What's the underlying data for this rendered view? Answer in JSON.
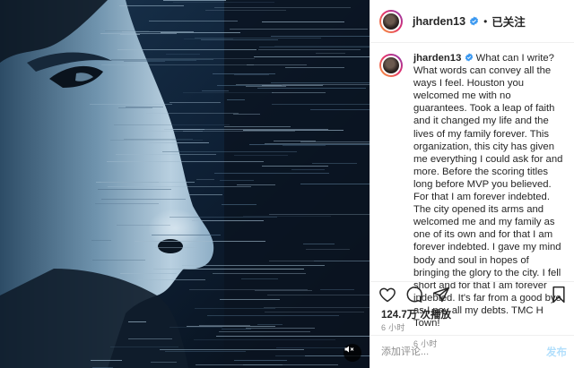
{
  "media": {
    "type": "video",
    "mute_icon": "speaker-mute-icon"
  },
  "header": {
    "username": "jharden13",
    "verified_icon": "verified-badge-icon",
    "separator": "•",
    "follow_label": "已关注"
  },
  "caption": {
    "username": "jharden13",
    "text": "What can I write? What words can convey all the ways I feel. Houston you welcomed me with no guarantees. Took a leap of faith and it changed my life and the lives of my family forever. This organization, this city has given me everything I could ask for and more. Before the scoring titles long before MVP you believed. For that I am forever indebted. The city opened its arms and welcomed me and my family as one of its own and for that I am forever indebted. I gave my mind body and soul in hopes of bringing the glory to the city. I fell short and for that I am forever indebted. It's far from a good bye as I pay all my debts. TMC H Town!",
    "time": "6 小时"
  },
  "actions": {
    "icons": [
      "heart-icon",
      "comment-icon",
      "share-icon",
      "bookmark-icon"
    ],
    "views": "124.7万 次播放",
    "time": "6 小时"
  },
  "comment_box": {
    "placeholder": "添加评论...",
    "post_label": "发布"
  },
  "colors": {
    "verified": "#3897f0",
    "post_disabled": "#b2dffc",
    "muted_text": "#8e8e8e",
    "border": "#efefef"
  }
}
